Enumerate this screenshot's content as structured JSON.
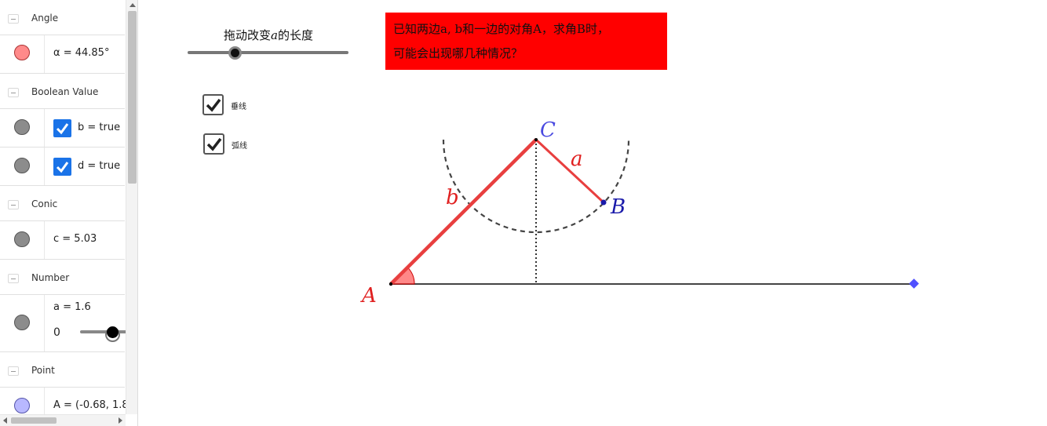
{
  "algebra": {
    "groups": {
      "angle": {
        "label": "Angle",
        "item": {
          "text": "α = 44.85°",
          "color": "#ff8a8a"
        }
      },
      "boolean": {
        "label": "Boolean Value",
        "items": [
          {
            "text": "b = true",
            "color": "#8c8c8c"
          },
          {
            "text": "d = true",
            "color": "#8c8c8c"
          }
        ]
      },
      "conic": {
        "label": "Conic",
        "item": {
          "text": "c = 5.03",
          "color": "#8c8c8c"
        }
      },
      "number": {
        "label": "Number",
        "item": {
          "text": "a = 1.6",
          "slider_min": "0",
          "color": "#8c8c8c"
        }
      },
      "point": {
        "label": "Point",
        "item": {
          "text": "A = (-0.68, 1.8",
          "color": "#b8b8ff"
        }
      }
    }
  },
  "graphics": {
    "slider_caption_prefix": "拖动改变",
    "slider_caption_var": "a",
    "slider_caption_suffix": "的长度",
    "slider_value": 1.6,
    "checkbox1_label": "垂线",
    "checkbox2_label": "弧线",
    "question_line1": "已知两边a, b和一边的对角A，求角B时，",
    "question_line2": "可能会出现哪几种情况？",
    "labels": {
      "A": "A",
      "B": "B",
      "C": "C",
      "a": "a",
      "b": "b"
    },
    "colors": {
      "red_line": "#e83f3f",
      "axis": "#444444",
      "blue_point": "#5050ff",
      "dark_blue": "#1a1aaa",
      "label_C": "#4a4ae0",
      "question_bg": "#ff0000"
    }
  }
}
